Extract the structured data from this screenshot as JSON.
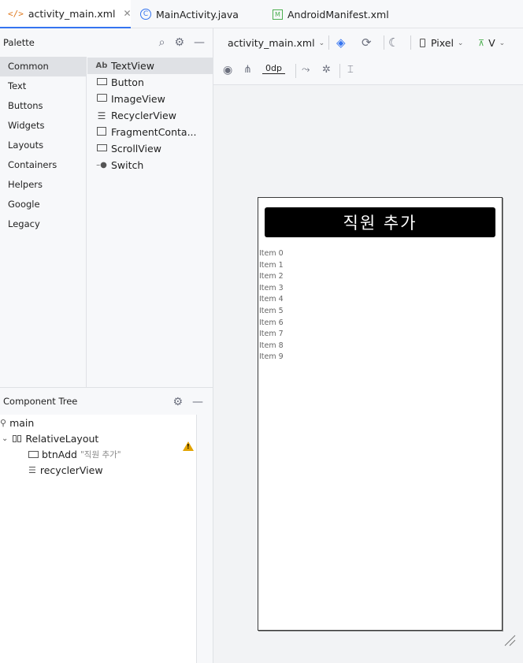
{
  "tabs": [
    {
      "label": "activity_main.xml",
      "icon": "xml-icon",
      "active": true
    },
    {
      "label": "MainActivity.java",
      "icon": "class-icon",
      "active": false
    },
    {
      "label": "AndroidManifest.xml",
      "icon": "manifest-icon",
      "active": false
    }
  ],
  "palette": {
    "title": "Palette",
    "categories": [
      "Common",
      "Text",
      "Buttons",
      "Widgets",
      "Layouts",
      "Containers",
      "Helpers",
      "Google",
      "Legacy"
    ],
    "selected_category": "Common",
    "items": [
      {
        "label": "TextView",
        "icon": "textview-icon"
      },
      {
        "label": "Button",
        "icon": "button-icon"
      },
      {
        "label": "ImageView",
        "icon": "imageview-icon"
      },
      {
        "label": "RecyclerView",
        "icon": "recyclerview-icon"
      },
      {
        "label": "FragmentConta...",
        "icon": "fragment-icon"
      },
      {
        "label": "ScrollView",
        "icon": "scrollview-icon"
      },
      {
        "label": "Switch",
        "icon": "switch-icon"
      }
    ]
  },
  "component_tree": {
    "title": "Component Tree",
    "nodes": [
      {
        "label": "main",
        "icon": "root-icon"
      },
      {
        "label": "RelativeLayout",
        "icon": "relativelayout-icon"
      },
      {
        "label": "btnAdd",
        "sub": "\"직원 추가\"",
        "icon": "button-icon",
        "warning": true
      },
      {
        "label": "recyclerView",
        "icon": "recyclerview-icon"
      }
    ]
  },
  "designer": {
    "file_dropdown": "activity_main.xml",
    "device": "Pixel",
    "api": "V",
    "margin": "0dp"
  },
  "preview": {
    "button_text": "직원 추가",
    "list_items": [
      "Item 0",
      "Item 1",
      "Item 2",
      "Item 3",
      "Item 4",
      "Item 5",
      "Item 6",
      "Item 7",
      "Item 8",
      "Item 9"
    ]
  },
  "colors": {
    "accent": "#3574f0",
    "warning": "#e2a300"
  }
}
